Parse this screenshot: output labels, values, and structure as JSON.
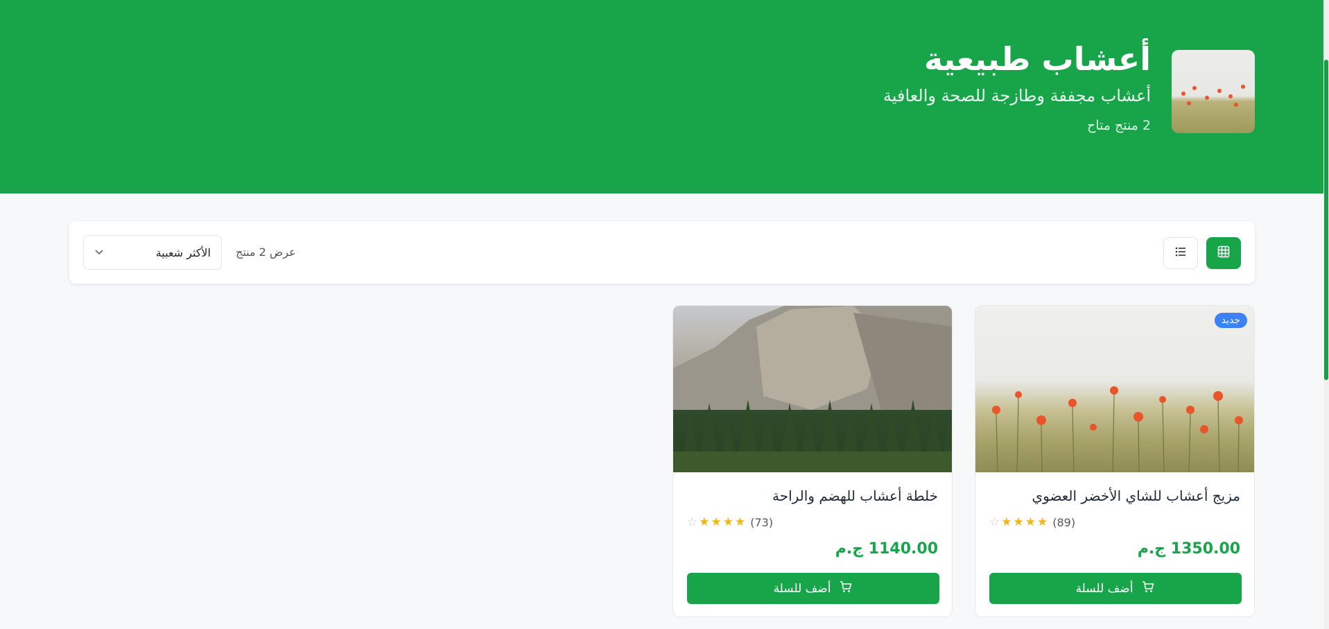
{
  "category": {
    "title": "أعشاب طبيعية",
    "subtitle": "أعشاب مجففة وطازجة للصحة والعافية",
    "count_text": "2 منتج متاح"
  },
  "toolbar": {
    "sort_value": "الأكثر شعبية",
    "result_text": "عرض 2 منتج"
  },
  "products": [
    {
      "title": "مزيج أعشاب للشاي الأخضر العضوي",
      "badge": "جديد",
      "reviews": "(89)",
      "rating": 4,
      "price": "1350.00 ج.م",
      "button": "أضف للسلة",
      "image": "poppy-field"
    },
    {
      "title": "خلطة أعشاب للهضم والراحة",
      "reviews": "(73)",
      "rating": 4,
      "price": "1140.00 ج.م",
      "button": "أضف للسلة",
      "image": "mountain-forest"
    }
  ],
  "colors": {
    "brand": "#18a54a",
    "badge": "#3b82f6",
    "star": "#f5b50a"
  }
}
